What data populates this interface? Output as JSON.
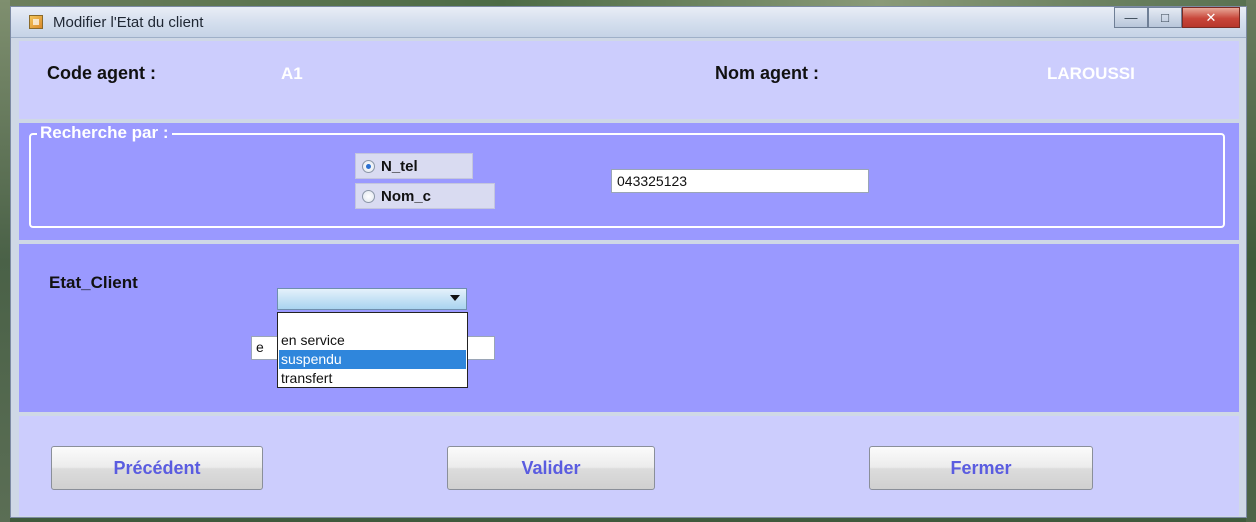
{
  "window": {
    "title": "Modifier l'Etat du client"
  },
  "controls": {
    "minimize_glyph": "—",
    "maximize_glyph": "□",
    "close_glyph": "✕"
  },
  "header": {
    "code_label": "Code agent :",
    "code_value": "A1",
    "nom_label": "Nom agent :",
    "nom_value": "LAROUSSI"
  },
  "search": {
    "legend": "Recherche par :",
    "options": [
      {
        "label": "N_tel",
        "selected": true
      },
      {
        "label": "Nom_c",
        "selected": false
      }
    ],
    "input_value": "043325123"
  },
  "etat": {
    "label": "Etat_Client",
    "selected_value": "",
    "hidden_field_value": "e",
    "options": [
      "en service",
      "suspendu",
      "transfert"
    ],
    "highlighted_option": "suspendu"
  },
  "buttons": {
    "previous": "Précédent",
    "validate": "Valider",
    "close": "Fermer"
  },
  "colors": {
    "header_panel": "#cccdfd",
    "search_panel": "#9a99ff",
    "button_text": "#5a5ce0",
    "selection": "#2f86dc"
  }
}
